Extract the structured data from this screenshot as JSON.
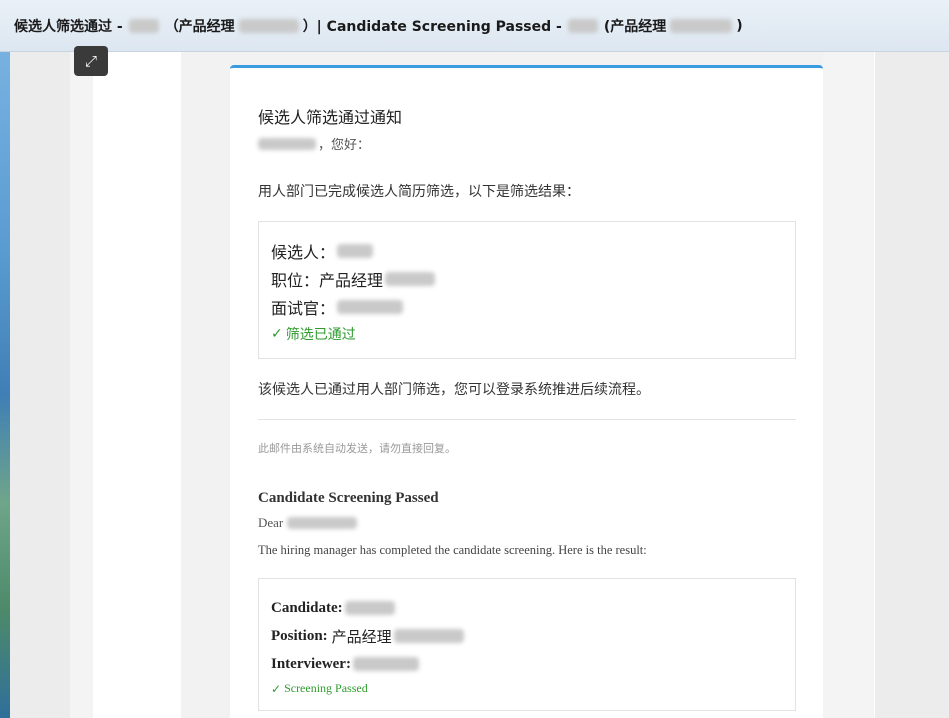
{
  "window": {
    "title_prefix": "候选人筛选通过 -",
    "title_mid1": "（产品经理",
    "title_mid2": "）| Candidate Screening Passed -",
    "title_mid3": "(产品经理",
    "title_suffix": ")"
  },
  "viewer": {
    "expand_icon": "expand-icon"
  },
  "email_cn": {
    "heading": "候选人筛选通过通知",
    "greeting_suffix": "，您好：",
    "intro": "用人部门已完成候选人简历筛选，以下是筛选结果：",
    "candidate_label": "候选人：",
    "position_label": "职位：",
    "position_value": "产品经理",
    "interviewer_label": "面试官：",
    "status_check": "✓",
    "status_text": "筛选已通过",
    "followup": "该候选人已通过用人部门筛选，您可以登录系统推进后续流程。",
    "auto_note": "此邮件由系统自动发送，请勿直接回复。"
  },
  "email_en": {
    "heading": "Candidate Screening Passed",
    "greeting": "Dear",
    "intro": "The hiring manager has completed the candidate screening. Here is the result:",
    "candidate_label": "Candidate:",
    "position_label": "Position:",
    "position_value": "产品经理",
    "interviewer_label": "Interviewer:",
    "status_check": "✓",
    "status_text": "Screening Passed"
  },
  "colors": {
    "accent": "#3a9be0",
    "success": "#2e9b2e"
  }
}
